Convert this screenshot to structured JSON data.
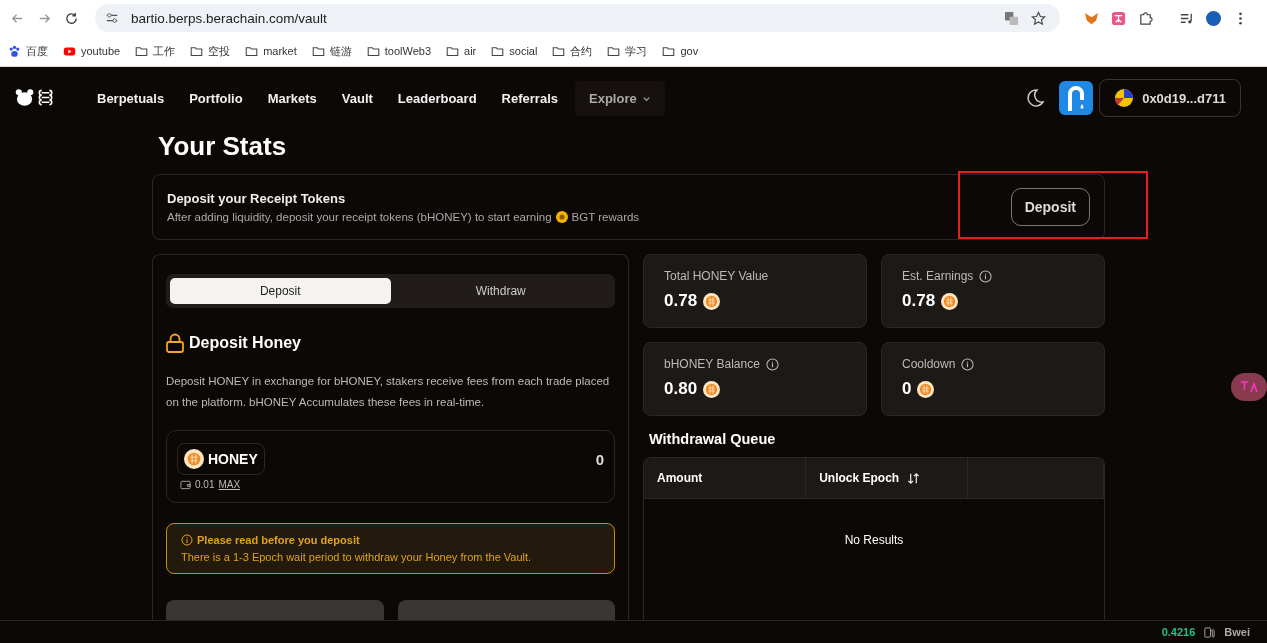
{
  "browser": {
    "url": "bartio.berps.berachain.com/vault",
    "bookmarks": [
      {
        "label": "百度",
        "kind": "paw"
      },
      {
        "label": "youtube",
        "kind": "video"
      },
      {
        "label": "工作",
        "kind": "folder"
      },
      {
        "label": "空投",
        "kind": "folder"
      },
      {
        "label": "market",
        "kind": "folder"
      },
      {
        "label": "链游",
        "kind": "folder"
      },
      {
        "label": "toolWeb3",
        "kind": "folder"
      },
      {
        "label": "air",
        "kind": "folder"
      },
      {
        "label": "social",
        "kind": "folder"
      },
      {
        "label": "合约",
        "kind": "folder"
      },
      {
        "label": "学习",
        "kind": "folder"
      },
      {
        "label": "gov",
        "kind": "folder"
      }
    ]
  },
  "nav": {
    "items": [
      {
        "label": "Berpetuals",
        "kind": "link"
      },
      {
        "label": "Portfolio",
        "kind": "link"
      },
      {
        "label": "Markets",
        "kind": "link"
      },
      {
        "label": "Vault",
        "kind": "link"
      },
      {
        "label": "Leaderboard",
        "kind": "link"
      },
      {
        "label": "Referrals",
        "kind": "link"
      },
      {
        "label": "Explore",
        "kind": "dropdown"
      }
    ],
    "wallet": "0x0d19...d711"
  },
  "page_title": "Your Stats",
  "banner": {
    "title": "Deposit your Receipt Tokens",
    "text_before": "After adding liquidity, deposit your receipt tokens (bHONEY) to start earning",
    "text_after": "BGT rewards",
    "button": "Deposit"
  },
  "tabs": [
    {
      "label": "Deposit",
      "selected": true
    },
    {
      "label": "Withdraw",
      "selected": false
    }
  ],
  "deposit": {
    "title": "Deposit Honey",
    "description": "Deposit HONEY in exchange for bHONEY, stakers receive fees from each trade placed on the platform. bHONEY Accumulates these fees in real-time.",
    "token": "HONEY",
    "amount": "0",
    "balance": "0.01",
    "max": "MAX",
    "notice": {
      "title": "Please read before you deposit",
      "text": "There is a 1-3 Epoch wait period to withdraw your Honey from the Vault."
    }
  },
  "stats": [
    {
      "label": "Total HONEY Value",
      "value": "0.78",
      "info": false
    },
    {
      "label": "Est. Earnings",
      "value": "0.78",
      "info": true
    },
    {
      "label": "bHONEY Balance",
      "value": "0.80",
      "info": true
    },
    {
      "label": "Cooldown",
      "value": "0",
      "info": true
    }
  ],
  "queue": {
    "title": "Withdrawal Queue",
    "columns": [
      {
        "label": "Amount",
        "sortable": false
      },
      {
        "label": "Unlock Epoch",
        "sortable": true
      }
    ],
    "empty": "No Results"
  },
  "status": {
    "gas": "0.4216",
    "unit": "Bwei"
  }
}
